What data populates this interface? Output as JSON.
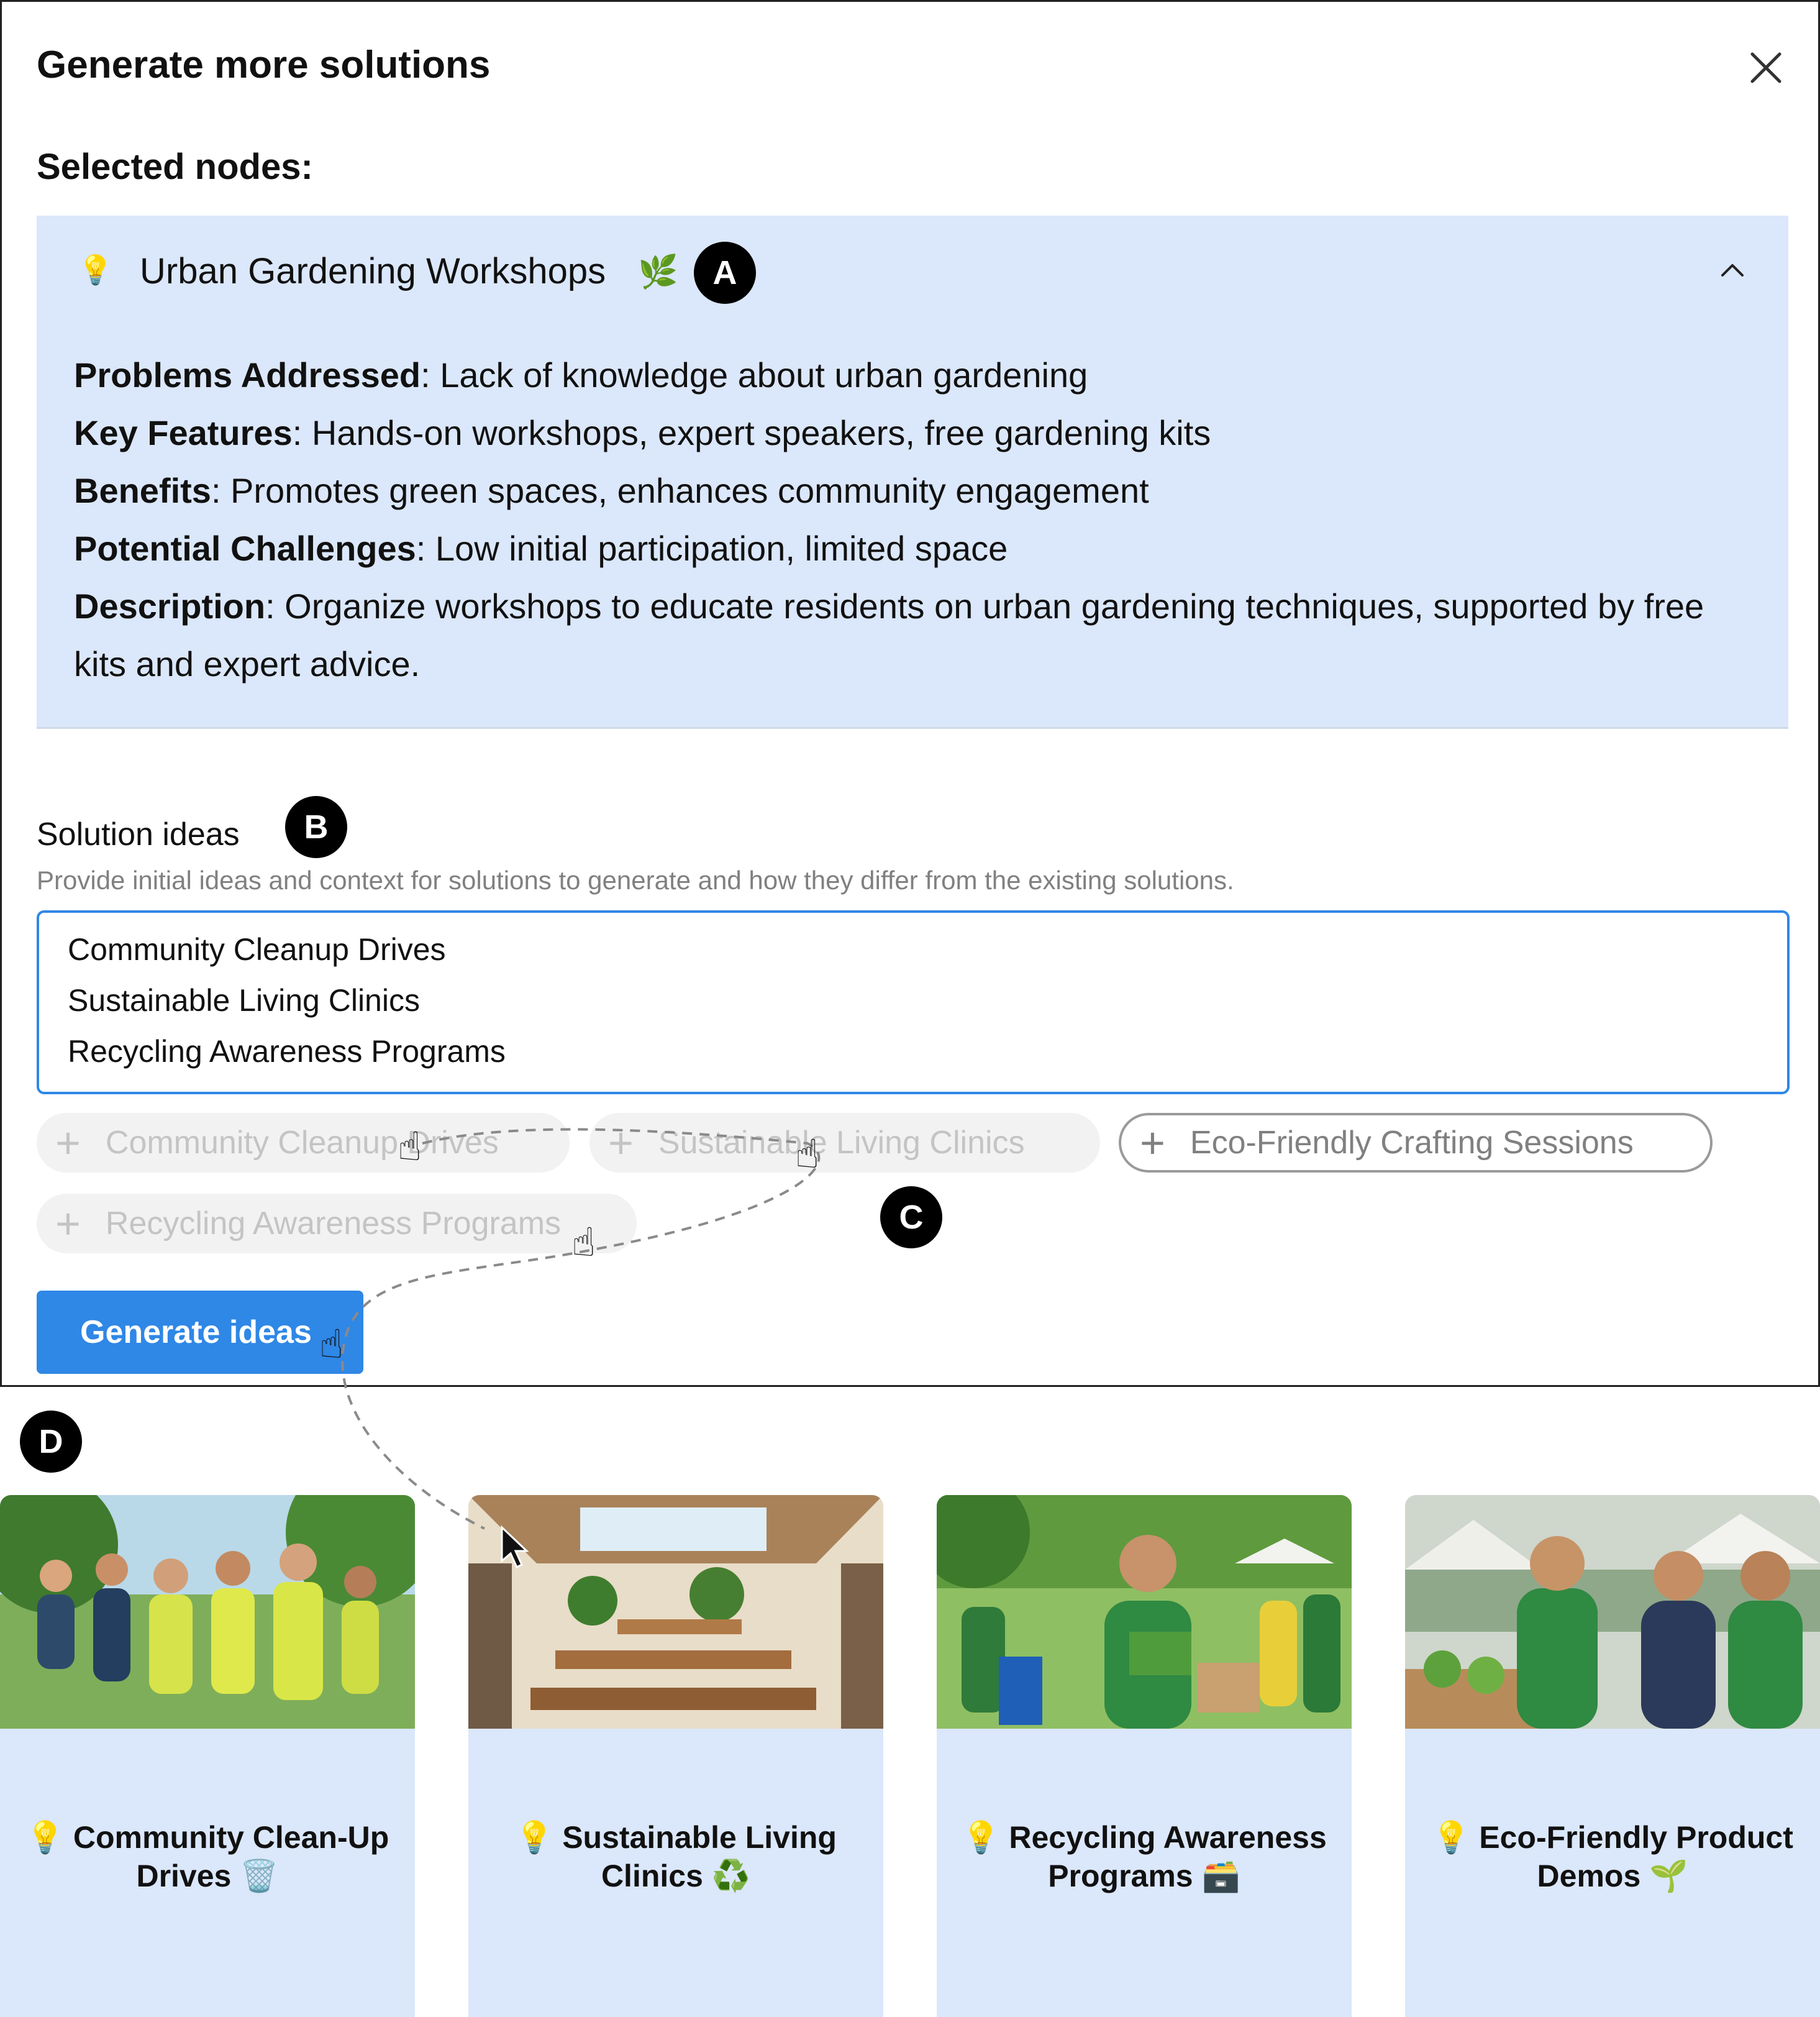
{
  "dialog": {
    "title": "Generate more solutions",
    "selected_label": "Selected nodes:"
  },
  "node": {
    "bulb": "💡",
    "title": "Urban Gardening Workshops",
    "emoji": "🌿",
    "fields": [
      {
        "label": "Problems Addressed",
        "value": ": Lack of knowledge about urban gardening"
      },
      {
        "label": "Key Features",
        "value": ": Hands-on workshops, expert speakers, free gardening kits"
      },
      {
        "label": "Benefits",
        "value": ": Promotes green spaces, enhances community engagement"
      },
      {
        "label": "Potential Challenges",
        "value": ": Low initial participation, limited space"
      },
      {
        "label": "Description",
        "value": ": Organize workshops to educate residents on urban gardening techniques, supported by free kits and expert advice."
      }
    ]
  },
  "badges": {
    "a": "A",
    "b": "B",
    "c": "C",
    "d": "D"
  },
  "solutions": {
    "label": "Solution ideas",
    "help": "Provide initial ideas and context for solutions to generate and how they differ from the existing solutions.",
    "lines": [
      "Community Cleanup Drives",
      "Sustainable Living Clinics",
      "Recycling Awareness Programs"
    ]
  },
  "chips": [
    {
      "label": "Community Cleanup Drives",
      "state": "used"
    },
    {
      "label": "Sustainable Living Clinics",
      "state": "used"
    },
    {
      "label": "Eco-Friendly Crafting Sessions",
      "state": "available"
    },
    {
      "label": "Recycling Awareness Programs",
      "state": "used"
    }
  ],
  "generate_button": "Generate ideas",
  "cards": [
    {
      "bulb": "💡",
      "line1": "Community Clean-Up",
      "line2": "Drives",
      "emoji": "🗑️",
      "image": "volunteers-in-park-image"
    },
    {
      "bulb": "💡",
      "line1": "Sustainable Living",
      "line2": "Clinics",
      "emoji": "♻️",
      "image": "community-hall-image"
    },
    {
      "bulb": "💡",
      "line1": "Recycling Awareness",
      "line2": "Programs",
      "emoji": "🗃️",
      "image": "recycling-event-image"
    },
    {
      "bulb": "💡",
      "line1": "Eco-Friendly Product",
      "line2": "Demos",
      "emoji": "🌱",
      "image": "market-stall-image"
    }
  ],
  "colors": {
    "accent": "#2f87e6",
    "card_bg": "#dbe7fa",
    "chip_used_bg": "#f2f2f2"
  }
}
